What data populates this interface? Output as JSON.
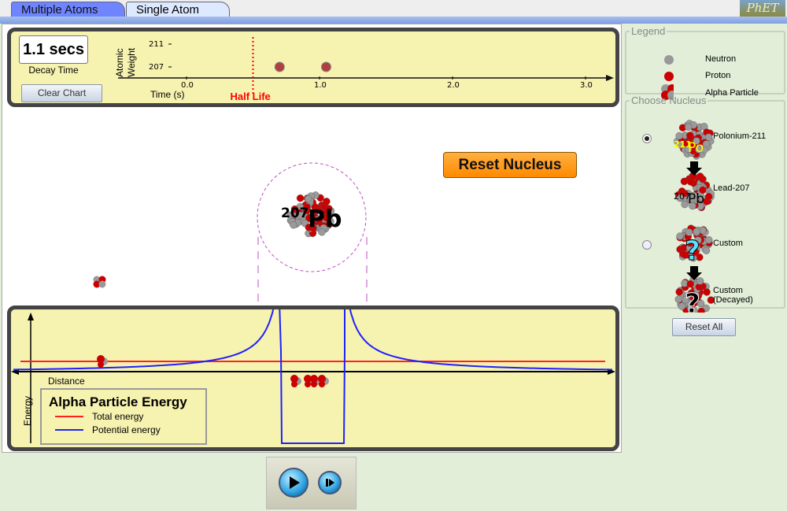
{
  "tabs": [
    {
      "label": "Multiple Atoms",
      "active": false
    },
    {
      "label": "Single Atom",
      "active": true
    }
  ],
  "logo": "PhET",
  "chart": {
    "decay_time": "1.1 secs",
    "decay_time_label": "Decay Time",
    "clear_button": "Clear Chart",
    "y_label_line1": "Atomic",
    "y_label_line2": "Weight",
    "y_ticks": [
      "211",
      "207"
    ],
    "x_ticks": [
      "0.0",
      "1.0",
      "2.0",
      "3.0"
    ],
    "x_label": "Time (s)",
    "half_life_label": "Half Life",
    "half_life_value": 0.5,
    "decay_points": [
      {
        "time": 0.7,
        "weight": 207
      },
      {
        "time": 1.05,
        "weight": 207
      }
    ],
    "half_life_color": "#ff0000"
  },
  "nucleus": {
    "mass": "207",
    "symbol": "Pb"
  },
  "reset_nucleus_button": "Reset Nucleus",
  "energy": {
    "x_label": "Distance",
    "y_label": "Energy",
    "legend_title": "Alpha Particle Energy",
    "legend": [
      {
        "label": "Total energy",
        "color": "#ff2020"
      },
      {
        "label": "Potential energy",
        "color": "#2020ff"
      }
    ]
  },
  "legend_panel": {
    "title": "Legend",
    "items": [
      "Neutron",
      "Proton",
      "Alpha Particle"
    ]
  },
  "choose_nucleus": {
    "title": "Choose Nucleus",
    "options": [
      {
        "label": "Polonium-211",
        "decay": "Lead-207",
        "selected": true,
        "mass": "211",
        "symbol": "Po",
        "decay_mass": "207",
        "decay_symbol": "Pb"
      },
      {
        "label": "Custom",
        "decay": "Custom (Decayed)",
        "selected": false,
        "symbol": "?",
        "decay_symbol": "?"
      }
    ]
  },
  "reset_all_button": "Reset All",
  "controls": {
    "play": "play-icon",
    "step": "step-icon"
  }
}
